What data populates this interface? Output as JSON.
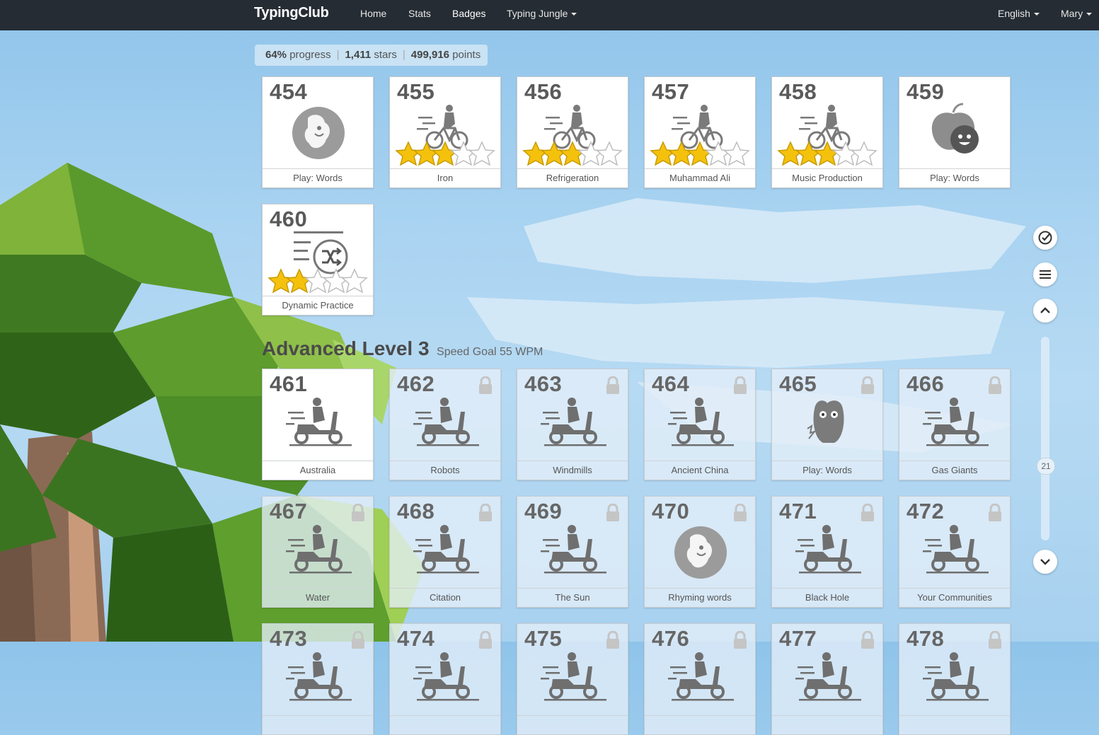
{
  "nav": {
    "brand": "TypingClub",
    "home": "Home",
    "stats": "Stats",
    "badges": "Badges",
    "typing_jungle": "Typing Jungle",
    "language": "English",
    "user": "Mary"
  },
  "stats": {
    "progress_value": "64%",
    "progress_label": "progress",
    "stars_value": "1,411",
    "stars_label": "stars",
    "points_value": "499,916",
    "points_label": "points"
  },
  "section": {
    "title": "Advanced Level 3",
    "subtitle": "Speed Goal 55 WPM"
  },
  "cards_top": [
    {
      "num": "454",
      "label": "Play: Words",
      "icon": "game-dodge-icon",
      "stars": 0,
      "locked": false
    },
    {
      "num": "455",
      "label": "Iron",
      "icon": "bicycle-icon",
      "stars": 3,
      "locked": false
    },
    {
      "num": "456",
      "label": "Refrigeration",
      "icon": "bicycle-icon",
      "stars": 3,
      "locked": false
    },
    {
      "num": "457",
      "label": "Muhammad Ali",
      "icon": "bicycle-icon",
      "stars": 3,
      "locked": false
    },
    {
      "num": "458",
      "label": "Music Production",
      "icon": "bicycle-icon",
      "stars": 3,
      "locked": false
    },
    {
      "num": "459",
      "label": "Play: Words",
      "icon": "game-apple-icon",
      "stars": 0,
      "locked": false
    },
    {
      "num": "460",
      "label": "Dynamic Practice",
      "icon": "shuffle-icon",
      "stars": 2,
      "locked": false
    }
  ],
  "cards_level": [
    {
      "num": "461",
      "label": "Australia",
      "icon": "scooter-icon",
      "locked": false
    },
    {
      "num": "462",
      "label": "Robots",
      "icon": "scooter-icon",
      "locked": true
    },
    {
      "num": "463",
      "label": "Windmills",
      "icon": "scooter-icon",
      "locked": true
    },
    {
      "num": "464",
      "label": "Ancient China",
      "icon": "scooter-icon",
      "locked": true
    },
    {
      "num": "465",
      "label": "Play: Words",
      "icon": "game-monster-icon",
      "locked": true
    },
    {
      "num": "466",
      "label": "Gas Giants",
      "icon": "scooter-icon",
      "locked": true
    },
    {
      "num": "467",
      "label": "Water",
      "icon": "scooter-icon",
      "locked": true
    },
    {
      "num": "468",
      "label": "Citation",
      "icon": "scooter-icon",
      "locked": true
    },
    {
      "num": "469",
      "label": "The Sun",
      "icon": "scooter-icon",
      "locked": true
    },
    {
      "num": "470",
      "label": "Rhyming words",
      "icon": "game-dodge-icon",
      "locked": true
    },
    {
      "num": "471",
      "label": "Black Hole",
      "icon": "scooter-icon",
      "locked": true
    },
    {
      "num": "472",
      "label": "Your Communities",
      "icon": "scooter-icon",
      "locked": true
    },
    {
      "num": "473",
      "label": "",
      "icon": "scooter-icon",
      "locked": true
    },
    {
      "num": "474",
      "label": "",
      "icon": "scooter-icon",
      "locked": true
    },
    {
      "num": "475",
      "label": "",
      "icon": "scooter-icon",
      "locked": true
    },
    {
      "num": "476",
      "label": "",
      "icon": "scooter-icon",
      "locked": true
    },
    {
      "num": "477",
      "label": "",
      "icon": "scooter-icon",
      "locked": true
    },
    {
      "num": "478",
      "label": "",
      "icon": "scooter-icon",
      "locked": true
    }
  ],
  "side": {
    "scroll_badge": "21",
    "icons": [
      "check-circle-icon",
      "menu-icon",
      "chevron-up-icon",
      "chevron-down-icon"
    ]
  },
  "colors": {
    "nav_bg": "#252c33",
    "star_fill": "#f4c20d",
    "card_text": "#555555"
  }
}
